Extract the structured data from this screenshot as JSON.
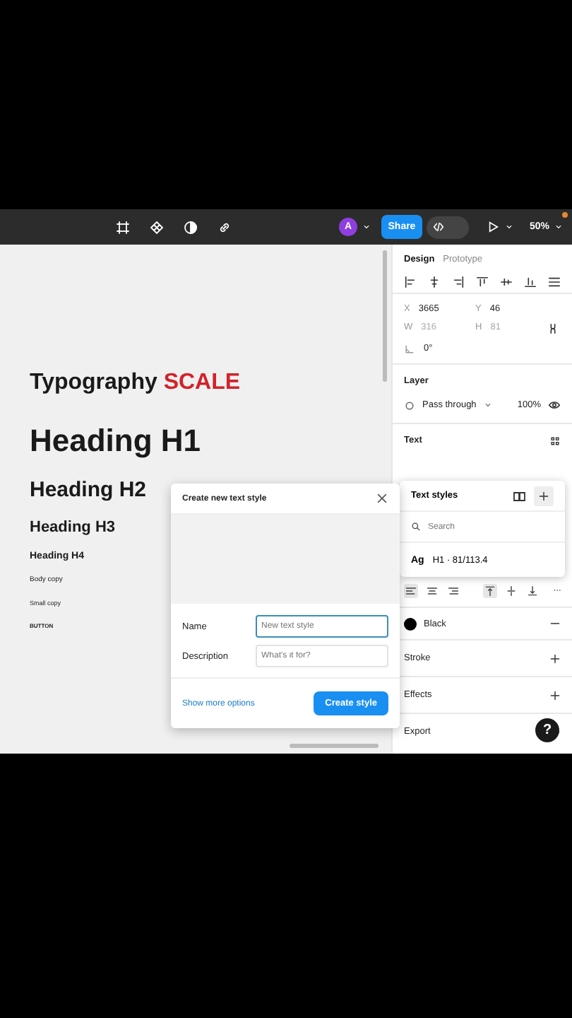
{
  "toolbar": {
    "avatar": "A",
    "share": "Share",
    "dev_mode": {
      "on": false
    },
    "zoom": "50%"
  },
  "canvas": {
    "title": {
      "text": "Typography",
      "accent": "SCALE"
    },
    "samples": [
      {
        "text": "Heading H1",
        "kind": "h1"
      },
      {
        "text": "Heading H2",
        "kind": "h2"
      },
      {
        "text": "Heading H3",
        "kind": "h3"
      },
      {
        "text": "Heading H4",
        "kind": "h4"
      },
      {
        "text": "Body copy",
        "kind": "body"
      },
      {
        "text": "Small copy",
        "kind": "small"
      },
      {
        "text": "BUTTON",
        "kind": "button"
      }
    ]
  },
  "panel": {
    "tabs": [
      {
        "label": "Design",
        "selected": true
      },
      {
        "label": "Prototype",
        "selected": false
      }
    ],
    "position": [
      {
        "label": "X",
        "value": "3665",
        "disabled": false
      },
      {
        "label": "Y",
        "value": "46",
        "disabled": false
      },
      {
        "label": "W",
        "value": "316",
        "disabled": true
      },
      {
        "label": "H",
        "value": "81",
        "disabled": true
      }
    ],
    "rotation": "0°",
    "layer": {
      "title": "Layer",
      "blend": "Pass through",
      "opacity": "100%"
    },
    "text": {
      "title": "Text"
    },
    "horizontal_align": [
      {
        "selected": true
      },
      {
        "selected": false
      },
      {
        "selected": false
      }
    ],
    "vertical_align": [
      {
        "selected": true
      },
      {
        "selected": false
      },
      {
        "selected": false
      }
    ],
    "fill": {
      "label": "Black",
      "color": "#000000"
    },
    "sections": [
      "Stroke",
      "Effects",
      "Export"
    ]
  },
  "popover": {
    "title": "Text styles",
    "search_placeholder": "Search",
    "items": [
      {
        "sample": "Ag",
        "label": "H1 · 81/113.4"
      }
    ]
  },
  "modal": {
    "title": "Create new text style",
    "fields": [
      {
        "label": "Name",
        "placeholder": "New text style",
        "focused": true
      },
      {
        "label": "Description",
        "placeholder": "What's it for?",
        "focused": false
      }
    ],
    "link": "Show more options",
    "button": "Create style"
  },
  "help": "?"
}
